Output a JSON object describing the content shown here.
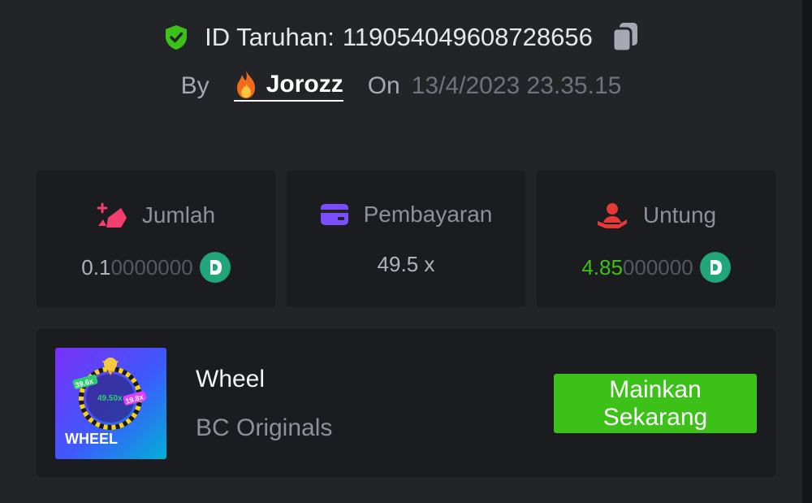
{
  "bet": {
    "id_label": "ID Taruhan:",
    "id_value": "1190540496087 28656",
    "by_label": "By",
    "username": "Jorozz",
    "on_label": "On",
    "date": "13/4/2023 23.35.15"
  },
  "stats": {
    "amount": {
      "label": "Jumlah",
      "value_main": "0.1",
      "value_trailing": "0000000"
    },
    "payout": {
      "label": "Pembayaran",
      "value": "49.5 x"
    },
    "profit": {
      "label": "Untung",
      "value_main": "4.85",
      "value_trailing": "000000"
    }
  },
  "game": {
    "thumb_title": "WHEEL",
    "thumb_badges": [
      "39.6x",
      "49.50x",
      "19.8x"
    ],
    "name": "Wheel",
    "provider": "BC Originals",
    "play_line1": "Mainkan",
    "play_line2": "Sekarang"
  },
  "colors": {
    "panel": "#232428",
    "card": "#1b1c1f",
    "accent_green": "#3bc117",
    "coin_teal": "#21a67a",
    "icon_pink": "#f43f6e",
    "icon_purple": "#7c4dff",
    "icon_red": "#e53935"
  },
  "icons": [
    "shield-check-icon",
    "copy-icon",
    "fire-icon",
    "coin-icon",
    "amount-icon",
    "card-icon",
    "profit-icon"
  ]
}
